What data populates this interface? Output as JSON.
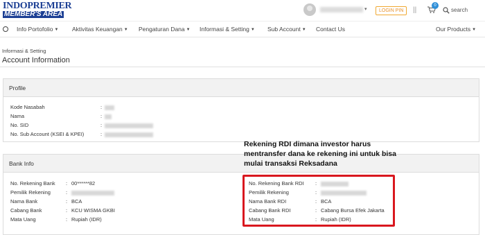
{
  "brand": {
    "line1": "INDOPREMIER",
    "line2": "MEMBER'S AREA"
  },
  "header": {
    "login_pin": "LOGIN PIN",
    "separator": "||",
    "cart_count": "0",
    "search_label": "search"
  },
  "nav": {
    "items": [
      {
        "label": "Info Portofolio"
      },
      {
        "label": "Aktivitas Keuangan"
      },
      {
        "label": "Pengaturan Dana"
      },
      {
        "label": "Informasi & Setting"
      },
      {
        "label": "Sub Account"
      },
      {
        "label": "Contact Us"
      },
      {
        "label": "Our Products"
      }
    ]
  },
  "page": {
    "breadcrumb": "Informasi & Setting",
    "title": "Account Information"
  },
  "profile": {
    "heading": "Profile",
    "rows": [
      {
        "label": "Kode Nasabah",
        "value": ""
      },
      {
        "label": "Nama",
        "value": ""
      },
      {
        "label": "No. SID",
        "value": ""
      },
      {
        "label": "No. Sub Account (KSEI & KPEI)",
        "value": ""
      }
    ]
  },
  "bank": {
    "heading": "Bank Info",
    "left": [
      {
        "label": "No. Rekening Bank",
        "value": "00******82"
      },
      {
        "label": "Pemilik Rekening",
        "value": ""
      },
      {
        "label": "Nama Bank",
        "value": "BCA"
      },
      {
        "label": "Cabang Bank",
        "value": "KCU WISMA GKBI"
      },
      {
        "label": "Mata Uang",
        "value": "Rupiah (IDR)"
      }
    ],
    "right": [
      {
        "label": "No. Rekening Bank RDI",
        "value": ""
      },
      {
        "label": "Pemilik Rekening",
        "value": ""
      },
      {
        "label": "Nama Bank RDI",
        "value": "BCA"
      },
      {
        "label": "Cabang Bank RDI",
        "value": "Cabang Bursa Efek Jakarta"
      },
      {
        "label": "Mata Uang",
        "value": "Rupiah (IDR)"
      }
    ],
    "colon": ":"
  },
  "annotation": {
    "line1": "Rekening RDI dimana investor harus",
    "line2": "mentransfer dana ke rekening ini untuk bisa",
    "line3": "mulai transaksi Reksadana",
    "color": "#d9171e"
  }
}
